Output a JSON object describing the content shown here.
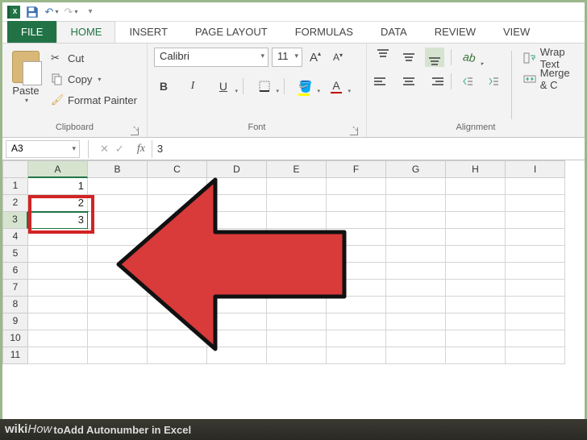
{
  "qat": {
    "excel": "X"
  },
  "tabs": {
    "file": "FILE",
    "home": "HOME",
    "insert": "INSERT",
    "pagelayout": "PAGE LAYOUT",
    "formulas": "FORMULAS",
    "data": "DATA",
    "review": "REVIEW",
    "view": "VIEW"
  },
  "ribbon": {
    "clipboard": {
      "paste": "Paste",
      "cut": "Cut",
      "copy": "Copy",
      "formatpainter": "Format Painter",
      "label": "Clipboard"
    },
    "font": {
      "name": "Calibri",
      "size": "11",
      "bold": "B",
      "italic": "I",
      "underline": "U",
      "label": "Font",
      "a_big": "A",
      "a_small": "A"
    },
    "alignment": {
      "wrap": "Wrap Text",
      "merge": "Merge & C",
      "label": "Alignment"
    }
  },
  "formula": {
    "namebox": "A3",
    "fx": "fx",
    "value": "3"
  },
  "grid": {
    "cols": [
      "A",
      "B",
      "C",
      "D",
      "E",
      "F",
      "G",
      "H",
      "I"
    ],
    "rows": [
      "1",
      "2",
      "3",
      "4",
      "5",
      "6",
      "7",
      "8",
      "9",
      "10",
      "11"
    ],
    "cells": {
      "A1": "1",
      "A2": "2",
      "A3": "3"
    },
    "activeCell": "A3",
    "selCol": "A",
    "selRow": "3"
  },
  "footer": {
    "brand_w": "wiki",
    "brand_h": "How",
    "sep": " ",
    "prefix": "to ",
    "title": "Add Autonumber in Excel"
  }
}
